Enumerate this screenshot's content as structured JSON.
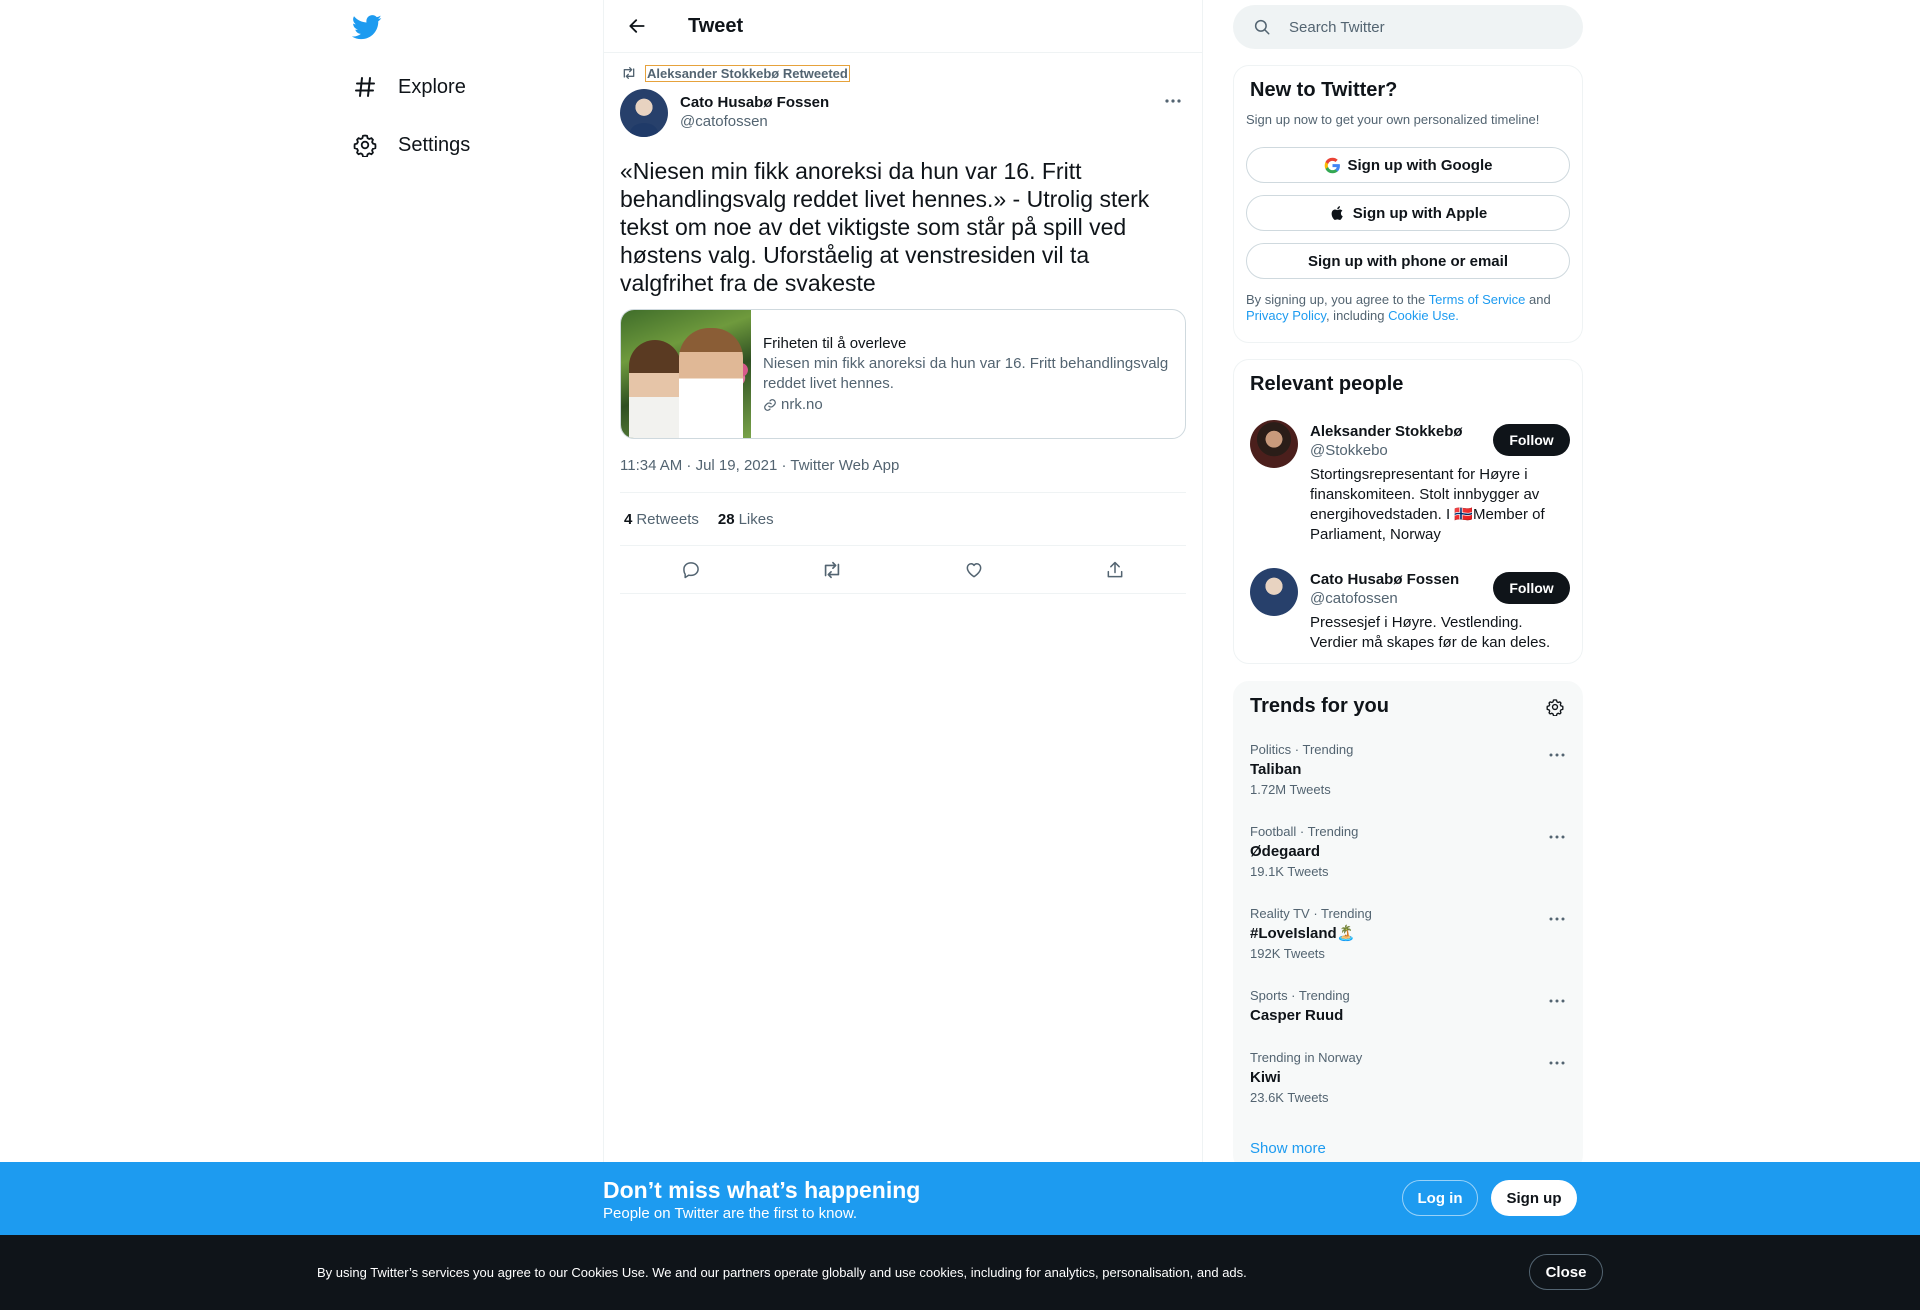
{
  "nav": {
    "logo": "twitter-bird-icon",
    "items": [
      {
        "label": "Explore",
        "icon": "hashtag-icon"
      },
      {
        "label": "Settings",
        "icon": "gear-icon"
      }
    ]
  },
  "header": {
    "title": "Tweet"
  },
  "tweet": {
    "retweeted_by": "Aleksander Stokkebø Retweeted",
    "author_name": "Cato Husabø Fossen",
    "author_handle": "@catofossen",
    "text": "«Niesen min fikk anoreksi da hun var 16. Fritt behandlingsvalg reddet livet hennes.» - Utrolig sterk tekst om noe av det viktigste som står på spill ved høstens valg. Uforståelig at venstresiden vil ta valgfrihet fra de svakeste",
    "card": {
      "title": "Friheten til å overleve",
      "description": "Niesen min fikk anoreksi da hun var 16. Fritt behandlingsvalg reddet livet hennes.",
      "domain": "nrk.no"
    },
    "meta": "11:34 AM · Jul 19, 2021 · Twitter Web App",
    "retweets_count": "4",
    "retweets_label": "Retweets",
    "likes_count": "28",
    "likes_label": "Likes"
  },
  "sidebar": {
    "search_placeholder": "Search Twitter",
    "new_to_twitter": {
      "title": "New to Twitter?",
      "subtitle": "Sign up now to get your own personalized timeline!",
      "google_label": "Sign up with Google",
      "apple_label": "Sign up with Apple",
      "phone_label": "Sign up with phone or email",
      "legal_prefix": "By signing up, you agree to the ",
      "terms": "Terms of Service",
      "and": " and ",
      "privacy": "Privacy Policy",
      "including": ", including ",
      "cookie": "Cookie Use."
    },
    "relevant": {
      "title": "Relevant people",
      "people": [
        {
          "name": "Aleksander Stokkebø",
          "handle": "@Stokkebo",
          "bio": "Stortingsrepresentant for Høyre i finanskomiteen. Stolt innbygger av energihovedstaden. I 🇳🇴Member of Parliament, Norway",
          "follow": "Follow"
        },
        {
          "name": "Cato Husabø Fossen",
          "handle": "@catofossen",
          "bio": "Pressesjef i Høyre. Vestlending. Verdier må skapes før de kan deles.",
          "follow": "Follow"
        }
      ]
    },
    "trends": {
      "title": "Trends for you",
      "items": [
        {
          "meta": "Politics · Trending",
          "name": "Taliban",
          "count": "1.72M Tweets"
        },
        {
          "meta": "Football · Trending",
          "name": "Ødegaard",
          "count": "19.1K Tweets"
        },
        {
          "meta": "Reality TV · Trending",
          "name": "#LoveIsland🏝️",
          "count": "192K Tweets"
        },
        {
          "meta": "Sports · Trending",
          "name": "Casper Ruud",
          "count": ""
        },
        {
          "meta": "Trending in Norway",
          "name": "Kiwi",
          "count": "23.6K Tweets"
        }
      ],
      "show_more": "Show more"
    }
  },
  "signup_bar": {
    "title": "Don’t miss what’s happening",
    "subtitle": "People on Twitter are the first to know.",
    "login": "Log in",
    "signup": "Sign up"
  },
  "cookie_bar": {
    "text": "By using Twitter’s services you agree to our Cookies Use. We and our partners operate globally and use cookies, including for analytics, personalisation, and ads.",
    "close": "Close"
  },
  "colors": {
    "accent": "#1d9bf0",
    "text": "#0f1419",
    "secondary": "#536471",
    "border": "#eff3f4",
    "dark": "#0f1419"
  }
}
